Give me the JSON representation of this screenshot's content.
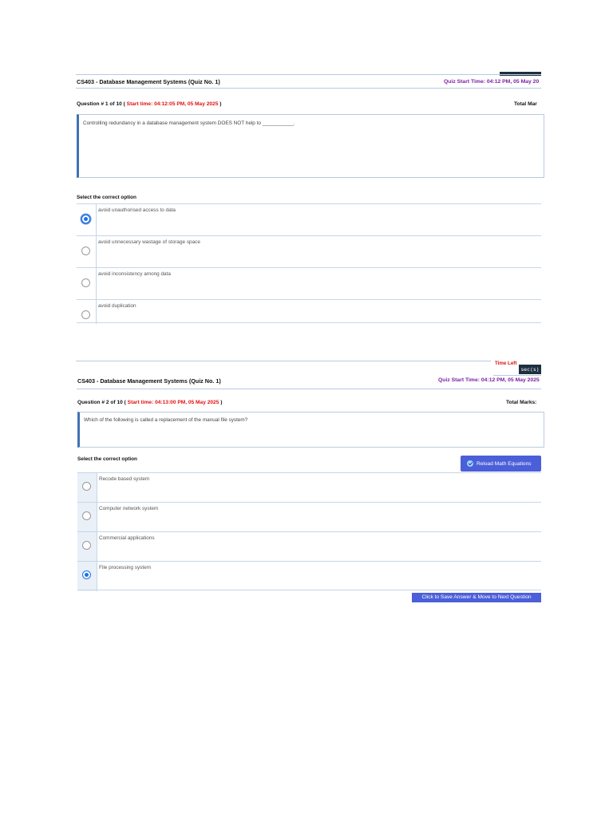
{
  "screenshots": [
    {
      "course_title": "CS403 - Database Management Systems (Quiz No. 1)",
      "quiz_start": "Quiz Start Time: 04:12 PM, 05 May 20",
      "question_prefix": "Question # 1 of 10 (",
      "question_start": "Start time: 04:12:05 PM, 05 May 2025",
      "question_suffix": ")",
      "total_marks": "Total Mar",
      "question_text": "Controlling redundancy in a database management system DOES NOT help to ___________.",
      "select_label": "Select the correct option",
      "options": [
        {
          "label": "avoid unauthorised access to data",
          "selected": true
        },
        {
          "label": "avoid unnecessary wastage of storage space",
          "selected": false
        },
        {
          "label": "avoid inconsistency among data",
          "selected": false
        },
        {
          "label": "avoid duplication",
          "selected": false
        }
      ]
    },
    {
      "time_left": "Time Left",
      "time_unit": "sec(s)",
      "course_title": "CS403 - Database Management Systems (Quiz No. 1)",
      "quiz_start": "Quiz Start Time: 04:12 PM, 05 May 2025",
      "question_prefix": "Question # 2 of 10 (",
      "question_start": "Start time: 04:13:00 PM, 05 May 2025",
      "question_suffix": ")",
      "total_marks": "Total Marks:",
      "question_text": "Which of the following is called a replacement of the manual file system?",
      "select_label": "Select the correct option",
      "reload_button": "Reload Math Equations",
      "options": [
        {
          "label": "Recode based system",
          "selected": false
        },
        {
          "label": "Computer network system",
          "selected": false
        },
        {
          "label": "Commercial applications",
          "selected": false
        },
        {
          "label": "File processing system",
          "selected": true
        }
      ],
      "save_button": "Click to Save Answer & Move to Next Question"
    }
  ],
  "colors": {
    "accent_blue": "#3f72b5",
    "button_blue": "#4b5fd9",
    "quiz_start_purple": "#7a1fa2",
    "start_time_red": "#e01010",
    "radio_selected": "#1a73e8"
  },
  "icons": {
    "reload": "check-circle-icon"
  }
}
